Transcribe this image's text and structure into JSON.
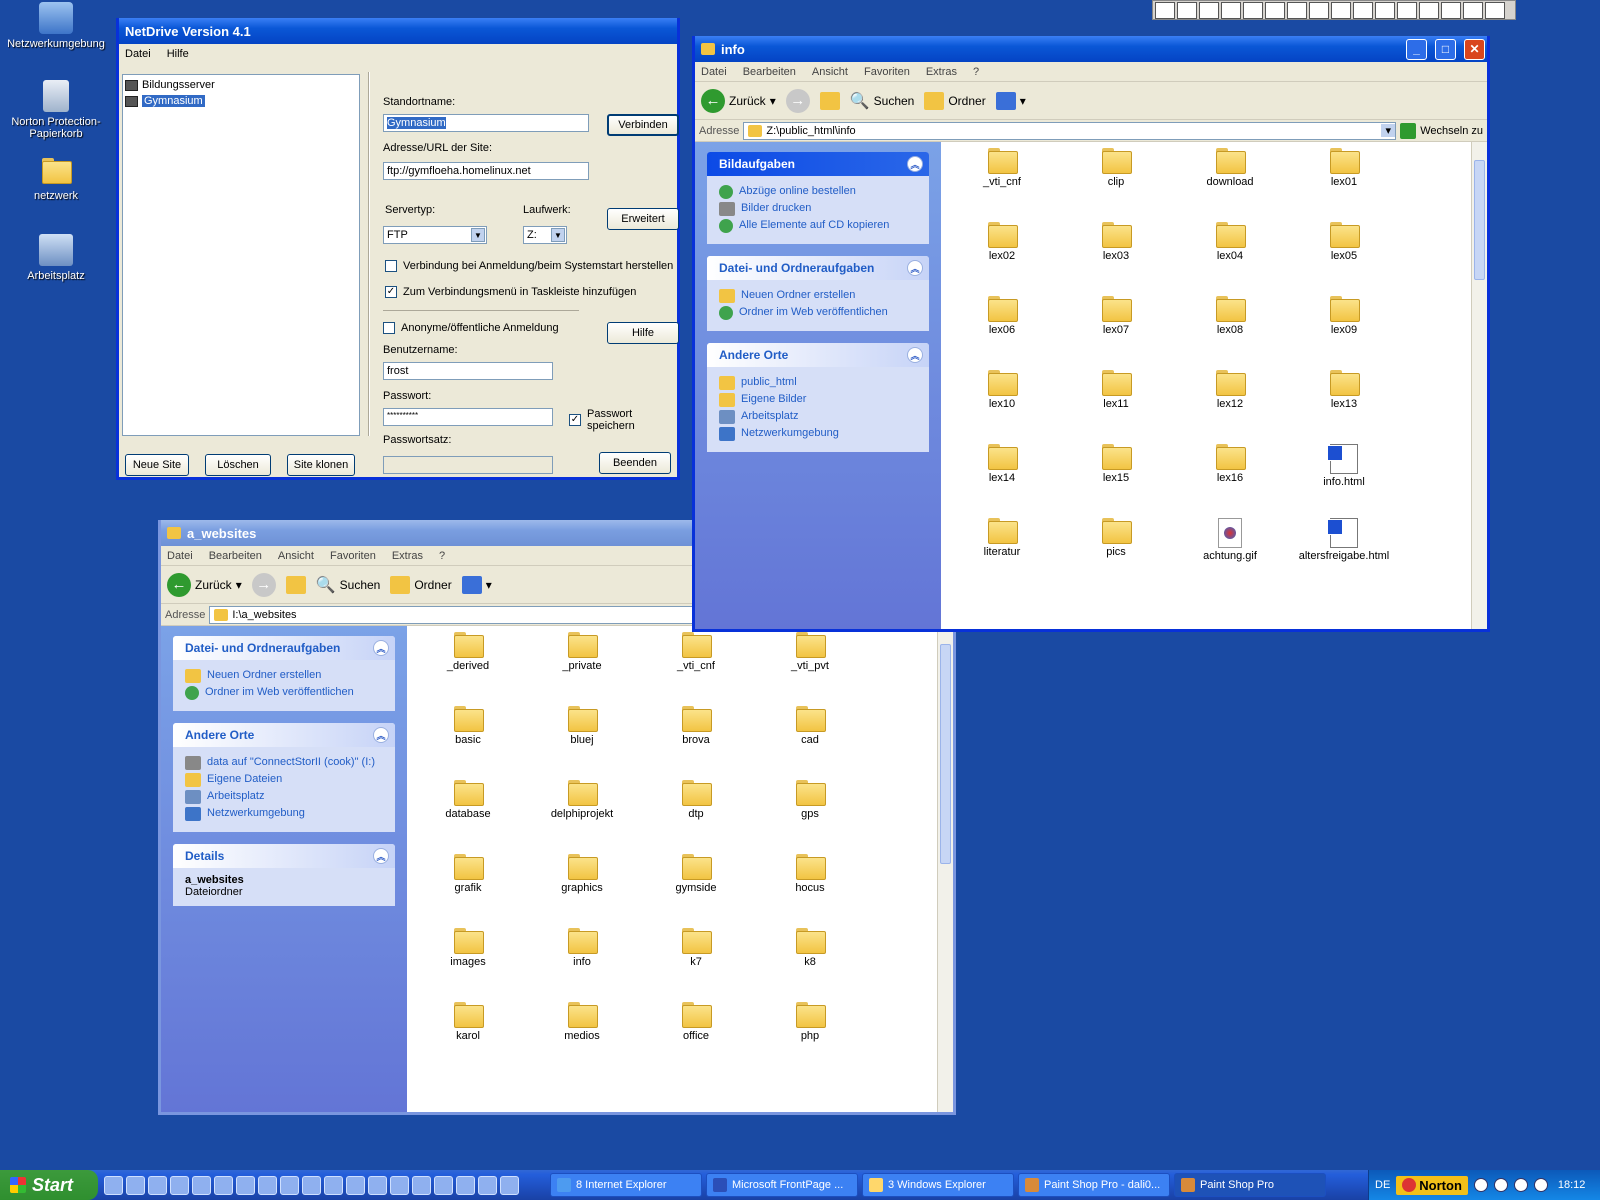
{
  "desktop": {
    "icons": [
      {
        "label": "Netzwerkumgebung"
      },
      {
        "label": "Norton Protection-Papierkorb"
      },
      {
        "label": "netzwerk"
      },
      {
        "label": "Arbeitsplatz"
      }
    ]
  },
  "netdrive": {
    "title": "NetDrive Version 4.1",
    "menu": [
      "Datei",
      "Hilfe"
    ],
    "sites": [
      "Bildungsserver",
      "Gymnasium"
    ],
    "standortname_label": "Standortname:",
    "standortname_value": "Gymnasium",
    "connect_button": "Verbinden",
    "url_label": "Adresse/URL der Site:",
    "url_value": "ftp://gymfloeha.homelinux.net",
    "servertyp_label": "Servertyp:",
    "servertyp_value": "FTP",
    "laufwerk_label": "Laufwerk:",
    "laufwerk_value": "Z:",
    "erweitert_button": "Erweitert",
    "chk_startup": "Verbindung bei Anmeldung/beim Systemstart herstellen",
    "chk_tray": "Zum Verbindungsmenü in Taskleiste hinzufügen",
    "chk_anon": "Anonyme/öffentliche Anmeldung",
    "hilfe_button": "Hilfe",
    "user_label": "Benutzername:",
    "user_value": "frost",
    "pass_label": "Passwort:",
    "pass_value": "**********",
    "save_pass": "Passwort speichern",
    "passsatz_label": "Passwortsatz:",
    "new_site": "Neue Site",
    "delete": "Löschen",
    "clone": "Site klonen",
    "exit": "Beenden"
  },
  "info": {
    "title": "info",
    "menu": [
      "Datei",
      "Bearbeiten",
      "Ansicht",
      "Favoriten",
      "Extras",
      "?"
    ],
    "back": "Zurück",
    "search": "Suchen",
    "folders": "Ordner",
    "address_label": "Adresse",
    "address": "Z:\\public_html\\info",
    "go": "Wechseln zu",
    "panels": [
      {
        "title": "Bildaufgaben",
        "items": [
          "Abzüge online bestellen",
          "Bilder drucken",
          "Alle Elemente auf CD kopieren"
        ]
      },
      {
        "title": "Datei- und Ordneraufgaben",
        "items": [
          "Neuen Ordner erstellen",
          "Ordner im Web veröffentlichen"
        ]
      },
      {
        "title": "Andere Orte",
        "items": [
          "public_html",
          "Eigene Bilder",
          "Arbeitsplatz",
          "Netzwerkumgebung"
        ]
      }
    ],
    "files": [
      {
        "name": "_vti_cnf",
        "type": "folder"
      },
      {
        "name": "clip",
        "type": "folder"
      },
      {
        "name": "download",
        "type": "folder"
      },
      {
        "name": "lex01",
        "type": "folder"
      },
      {
        "name": "lex02",
        "type": "folder"
      },
      {
        "name": "lex03",
        "type": "folder"
      },
      {
        "name": "lex04",
        "type": "folder"
      },
      {
        "name": "lex05",
        "type": "folder"
      },
      {
        "name": "lex06",
        "type": "folder"
      },
      {
        "name": "lex07",
        "type": "folder"
      },
      {
        "name": "lex08",
        "type": "folder"
      },
      {
        "name": "lex09",
        "type": "folder"
      },
      {
        "name": "lex10",
        "type": "folder"
      },
      {
        "name": "lex11",
        "type": "folder"
      },
      {
        "name": "lex12",
        "type": "folder"
      },
      {
        "name": "lex13",
        "type": "folder"
      },
      {
        "name": "lex14",
        "type": "folder"
      },
      {
        "name": "lex15",
        "type": "folder"
      },
      {
        "name": "lex16",
        "type": "folder"
      },
      {
        "name": "info.html",
        "type": "html"
      },
      {
        "name": "literatur",
        "type": "folder"
      },
      {
        "name": "pics",
        "type": "folder"
      },
      {
        "name": "achtung.gif",
        "type": "gif"
      },
      {
        "name": "altersfreigabe.html",
        "type": "html"
      }
    ]
  },
  "websites": {
    "title": "a_websites",
    "menu": [
      "Datei",
      "Bearbeiten",
      "Ansicht",
      "Favoriten",
      "Extras",
      "?"
    ],
    "back": "Zurück",
    "search": "Suchen",
    "folders": "Ordner",
    "address_label": "Adresse",
    "address": "I:\\a_websites",
    "panels": [
      {
        "title": "Datei- und Ordneraufgaben",
        "items": [
          "Neuen Ordner erstellen",
          "Ordner im Web veröffentlichen"
        ]
      },
      {
        "title": "Andere Orte",
        "items": [
          "data auf \"ConnectStorII (cook)\" (I:)",
          "Eigene Dateien",
          "Arbeitsplatz",
          "Netzwerkumgebung"
        ]
      }
    ],
    "details_title": "Details",
    "details_name": "a_websites",
    "details_type": "Dateiordner",
    "files": [
      "_derived",
      "_private",
      "_vti_cnf",
      "_vti_pvt",
      "basic",
      "bluej",
      "brova",
      "cad",
      "database",
      "delphiprojekt",
      "dtp",
      "gps",
      "grafik",
      "graphics",
      "gymside",
      "hocus",
      "images",
      "info",
      "k7",
      "k8",
      "karol",
      "medios",
      "office",
      "php"
    ]
  },
  "taskbar": {
    "start": "Start",
    "tasks": [
      "8 Internet Explorer",
      "Microsoft FrontPage ...",
      "3 Windows Explorer",
      "Paint Shop Pro - dali0...",
      "Paint Shop Pro"
    ],
    "lang": "DE",
    "norton": "Norton",
    "clock": "18:12"
  }
}
